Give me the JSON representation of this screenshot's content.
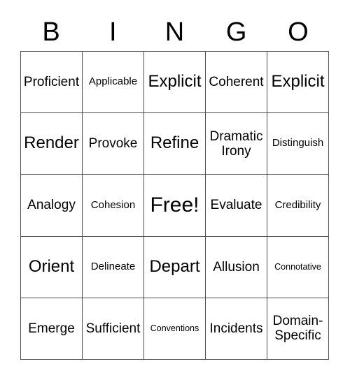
{
  "header": {
    "letters": [
      "B",
      "I",
      "N",
      "G",
      "O"
    ]
  },
  "grid": {
    "columns": 5,
    "rows": 5,
    "cells": [
      {
        "text": "Proficient",
        "size": "md"
      },
      {
        "text": "Applicable",
        "size": "sm"
      },
      {
        "text": "Explicit",
        "size": "lg"
      },
      {
        "text": "Coherent",
        "size": "md"
      },
      {
        "text": "Explicit",
        "size": "lg"
      },
      {
        "text": "Render",
        "size": "lg"
      },
      {
        "text": "Provoke",
        "size": "md"
      },
      {
        "text": "Refine",
        "size": "lg"
      },
      {
        "text": "Dramatic Irony",
        "size": "md"
      },
      {
        "text": "Distinguish",
        "size": "sm"
      },
      {
        "text": "Analogy",
        "size": "md"
      },
      {
        "text": "Cohesion",
        "size": "sm"
      },
      {
        "text": "Free!",
        "size": "xl"
      },
      {
        "text": "Evaluate",
        "size": "md"
      },
      {
        "text": "Credibility",
        "size": "sm"
      },
      {
        "text": "Orient",
        "size": "lg"
      },
      {
        "text": "Delineate",
        "size": "sm"
      },
      {
        "text": "Depart",
        "size": "lg"
      },
      {
        "text": "Allusion",
        "size": "md"
      },
      {
        "text": "Connotative",
        "size": "xs"
      },
      {
        "text": "Emerge",
        "size": "md"
      },
      {
        "text": "Sufficient",
        "size": "md"
      },
      {
        "text": "Conventions",
        "size": "xs"
      },
      {
        "text": "Incidents",
        "size": "md"
      },
      {
        "text": "Domain-Specific",
        "size": "md"
      }
    ]
  },
  "colors": {
    "background": "#ffffff",
    "text": "#000000",
    "grid_line": "#4d4d4d"
  }
}
